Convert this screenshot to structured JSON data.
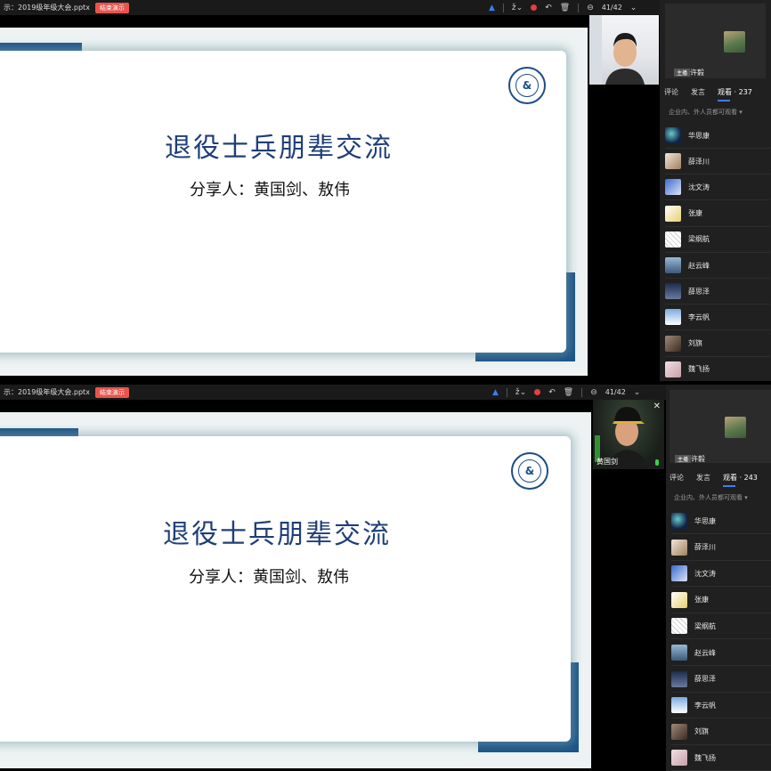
{
  "toolbar": {
    "top": {
      "filename": "示：2019级年级大会.pptx",
      "end_label": "结束演示",
      "page": "41/42"
    },
    "bottom": {
      "filename": "示：2019级年级大会.pptx",
      "end_label": "结束演示",
      "page": "41/42"
    }
  },
  "icons": {
    "cursor": "▲",
    "pen": "ž",
    "caret": "⌄",
    "undo": "↶",
    "trash": "🗑",
    "minus": "⊖",
    "chevron": "⌄",
    "close": "✕"
  },
  "slide": {
    "title": "退役士兵朋辈交流",
    "subtitle": "分享人：黄国剑、敖伟",
    "logo_glyph": "&",
    "accent_color": "#1c5488",
    "title_color": "#1e3f78"
  },
  "camera": {
    "bottom_name": "黄国剑"
  },
  "sidebar": {
    "top": {
      "host_tag": "主播",
      "host_name": "许毅",
      "tabs": [
        {
          "label": "评论"
        },
        {
          "label": "发言"
        },
        {
          "label": "观看 · 237"
        }
      ],
      "notice": "企业内、外人员都可观看 ▾",
      "viewers": [
        {
          "name": "华思康"
        },
        {
          "name": "薛泽川"
        },
        {
          "name": "沈文涛"
        },
        {
          "name": "张康"
        },
        {
          "name": "梁纲航"
        },
        {
          "name": "赵云峰"
        },
        {
          "name": "薛思泽"
        },
        {
          "name": "李云帆"
        },
        {
          "name": "刘旗"
        },
        {
          "name": "魏飞扬"
        }
      ]
    },
    "bottom": {
      "host_tag": "主播",
      "host_name": "许毅",
      "tabs": [
        {
          "label": "评论"
        },
        {
          "label": "发言"
        },
        {
          "label": "观看 · 243"
        }
      ],
      "notice": "企业内、外人员都可观看 ▾",
      "viewers": [
        {
          "name": "华思康"
        },
        {
          "name": "薛泽川"
        },
        {
          "name": "沈文涛"
        },
        {
          "name": "张康"
        },
        {
          "name": "梁纲航"
        },
        {
          "name": "赵云峰"
        },
        {
          "name": "薛思泽"
        },
        {
          "name": "李云帆"
        },
        {
          "name": "刘旗"
        },
        {
          "name": "魏飞扬"
        }
      ]
    }
  }
}
